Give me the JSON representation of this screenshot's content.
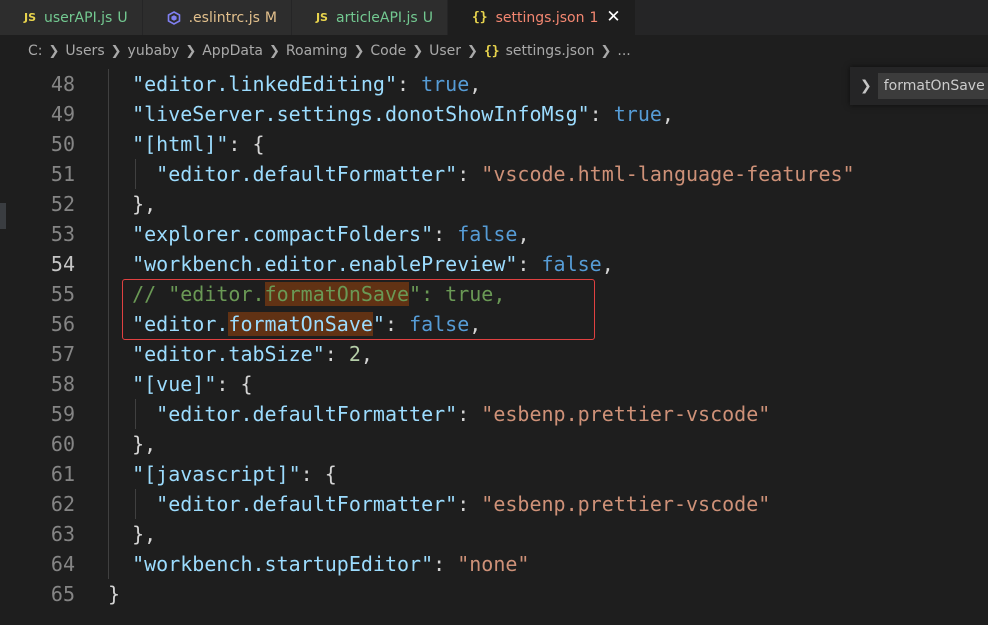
{
  "tabs": [
    {
      "icon": "JS",
      "name": "userAPI.js",
      "badge": "U",
      "status": "untracked"
    },
    {
      "icon": "eslint",
      "name": ".eslintrc.js",
      "badge": "M",
      "status": "modified"
    },
    {
      "icon": "JS",
      "name": "articleAPI.js",
      "badge": "U",
      "status": "untracked"
    },
    {
      "icon": "{}",
      "name": "settings.json",
      "badge": "1",
      "status": "error",
      "active": true,
      "close": "✕"
    }
  ],
  "breadcrumb": {
    "items": [
      "C:",
      "Users",
      "yubaby",
      "AppData",
      "Roaming",
      "Code",
      "User"
    ],
    "file_icon": "{}",
    "file": "settings.json",
    "tail": "..."
  },
  "find_widget": {
    "query": "formatOnSave",
    "toggle_icon": "chevron-right-icon"
  },
  "editor": {
    "current_line": "54",
    "lines": [
      {
        "num": "48",
        "indent": "  ",
        "key": "\"editor.linkedEditing\"",
        "colon": ": ",
        "value": "true",
        "vtype": "b",
        "tail": ","
      },
      {
        "num": "49",
        "indent": "  ",
        "key": "\"liveServer.settings.donotShowInfoMsg\"",
        "colon": ": ",
        "value": "true",
        "vtype": "b",
        "tail": ","
      },
      {
        "num": "50",
        "indent": "  ",
        "key": "\"[html]\"",
        "colon": ": ",
        "value": "{",
        "vtype": "p",
        "tail": ""
      },
      {
        "num": "51",
        "indent": "    ",
        "key": "\"editor.defaultFormatter\"",
        "colon": ": ",
        "value": "\"vscode.html-language-features\"",
        "vtype": "s",
        "tail": "",
        "guide": true
      },
      {
        "num": "52",
        "indent": "  ",
        "key": "",
        "colon": "",
        "value": "},",
        "vtype": "p",
        "tail": ""
      },
      {
        "num": "53",
        "indent": "  ",
        "key": "\"explorer.compactFolders\"",
        "colon": ": ",
        "value": "false",
        "vtype": "b",
        "tail": ","
      },
      {
        "num": "54",
        "indent": "  ",
        "key": "\"workbench.editor.enablePreview\"",
        "colon": ": ",
        "value": "false",
        "vtype": "b",
        "tail": ","
      },
      {
        "num": "55",
        "comment": "  // \"editor.",
        "comment_hl": "formatOnSave",
        "comment_tail": "\": true,"
      },
      {
        "num": "56",
        "indent": "  ",
        "key_pre": "\"editor.",
        "key_hl": "formatOnSave",
        "key_post": "\"",
        "colon": ": ",
        "value": "false",
        "vtype": "b",
        "tail": ","
      },
      {
        "num": "57",
        "indent": "  ",
        "key": "\"editor.tabSize\"",
        "colon": ": ",
        "value": "2",
        "vtype": "n",
        "tail": ","
      },
      {
        "num": "58",
        "indent": "  ",
        "key": "\"[vue]\"",
        "colon": ": ",
        "value": "{",
        "vtype": "p",
        "tail": ""
      },
      {
        "num": "59",
        "indent": "    ",
        "key": "\"editor.defaultFormatter\"",
        "colon": ": ",
        "value": "\"esbenp.prettier-vscode\"",
        "vtype": "s",
        "tail": "",
        "guide": true
      },
      {
        "num": "60",
        "indent": "  ",
        "key": "",
        "colon": "",
        "value": "},",
        "vtype": "p",
        "tail": ""
      },
      {
        "num": "61",
        "indent": "  ",
        "key": "\"[javascript]\"",
        "colon": ": ",
        "value": "{",
        "vtype": "p",
        "tail": ""
      },
      {
        "num": "62",
        "indent": "    ",
        "key": "\"editor.defaultFormatter\"",
        "colon": ": ",
        "value": "\"esbenp.prettier-vscode\"",
        "vtype": "s",
        "tail": "",
        "guide": true
      },
      {
        "num": "63",
        "indent": "  ",
        "key": "",
        "colon": "",
        "value": "},",
        "vtype": "p",
        "tail": ""
      },
      {
        "num": "64",
        "indent": "  ",
        "key": "\"workbench.startupEditor\"",
        "colon": ": ",
        "value": "\"none\"",
        "vtype": "s",
        "tail": ""
      },
      {
        "num": "65",
        "indent": "",
        "key": "",
        "colon": "",
        "value": "}",
        "vtype": "p",
        "tail": "",
        "noguide": true
      }
    ]
  },
  "colors": {
    "background": "#1e1e1e",
    "key": "#9cdcfe",
    "string": "#ce9178",
    "boolean": "#569cd6",
    "number": "#b5cea8",
    "comment": "#6a9955",
    "highlight": "#613214",
    "annotation_box": "#e04141"
  }
}
